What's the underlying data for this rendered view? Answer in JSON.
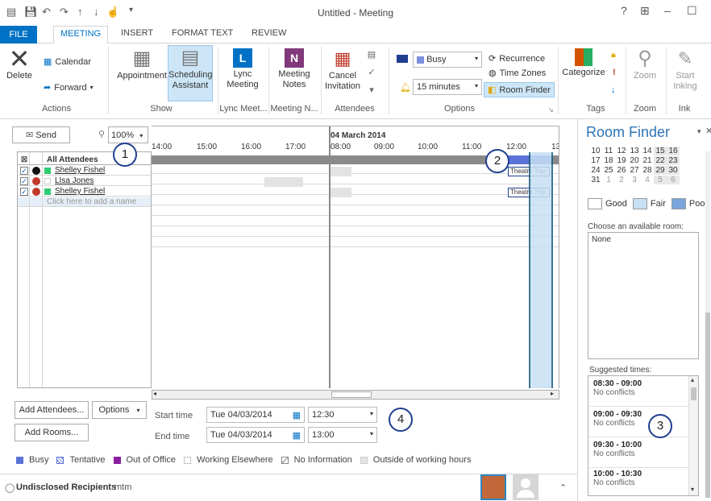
{
  "window": {
    "title": "Untitled - Meeting",
    "help": "?",
    "restore": "⊞",
    "minimize": "–",
    "maximize": "☐"
  },
  "tabs": [
    "FILE",
    "MEETING",
    "INSERT",
    "FORMAT TEXT",
    "REVIEW"
  ],
  "ribbon": {
    "actions": {
      "delete": "Delete",
      "calendar": "Calendar",
      "forward": "Forward",
      "label": "Actions"
    },
    "show": {
      "appointment": "Appointment",
      "scheduling": "Scheduling Assistant",
      "label": "Show"
    },
    "lync": {
      "button": "Lync Meeting",
      "label": "Lync Meet..."
    },
    "notes": {
      "button": "Meeting Notes",
      "label": "Meeting N..."
    },
    "attendees": {
      "cancel": "Cancel Invitation",
      "label": "Attendees"
    },
    "options": {
      "busy": "Busy",
      "reminder": "15 minutes",
      "recurrence": "Recurrence",
      "timezones": "Time Zones",
      "roomfinder": "Room Finder",
      "label": "Options"
    },
    "tags": {
      "categorize": "Categorize",
      "label": "Tags"
    },
    "zoom": {
      "button": "Zoom",
      "label": "Zoom"
    },
    "ink": {
      "button": "Start Inking",
      "label": "Ink"
    }
  },
  "scheduler": {
    "send": "Send",
    "zoom": "100%",
    "header_all": "All Attendees",
    "date": "04 March 2014",
    "hours": [
      "14:00",
      "15:00",
      "16:00",
      "17:00",
      "08:00",
      "09:00",
      "10:00",
      "11:00",
      "12:00",
      "13"
    ],
    "attendees": [
      {
        "name": "Shelley Fishel"
      },
      {
        "name": "LIsa Jones"
      },
      {
        "name": "Shelley Fishel"
      }
    ],
    "add_name": "Click here to add a name",
    "event1": "Theatre Trip",
    "event2": "Theatre Trip",
    "add_attendees": "Add Attendees...",
    "options": "Options",
    "add_rooms": "Add Rooms...",
    "start_label": "Start time",
    "start_date": "Tue 04/03/2014",
    "start_time": "12:30",
    "end_label": "End time",
    "end_date": "Tue 04/03/2014",
    "end_time": "13:00"
  },
  "legend": {
    "busy": "Busy",
    "tentative": "Tentative",
    "oof": "Out of Office",
    "elsewhere": "Working Elsewhere",
    "noinfo": "No Information",
    "outside": "Outside of working hours"
  },
  "status": {
    "recipients": "Undisclosed Recipients",
    "suffix": "mtm"
  },
  "roomfinder": {
    "title": "Room Finder",
    "cal_rows": [
      [
        "10",
        "11",
        "12",
        "13",
        "14",
        "15",
        "16"
      ],
      [
        "17",
        "18",
        "19",
        "20",
        "21",
        "22",
        "23"
      ],
      [
        "24",
        "25",
        "26",
        "27",
        "28",
        "29",
        "30"
      ],
      [
        "31",
        "1",
        "2",
        "3",
        "4",
        "5",
        "6"
      ]
    ],
    "good": "Good",
    "fair": "Fair",
    "poor": "Poor",
    "choose": "Choose an available room:",
    "room_value": "None",
    "suggested": "Suggested times:",
    "times": [
      {
        "time": "08:30 - 09:00",
        "status": "No conflicts"
      },
      {
        "time": "09:00 - 09:30",
        "status": "No conflicts"
      },
      {
        "time": "09:30 - 10:00",
        "status": "No conflicts"
      },
      {
        "time": "10:00 - 10:30",
        "status": "No conflicts"
      }
    ]
  },
  "callouts": [
    "1",
    "2",
    "3",
    "4"
  ],
  "colors": {
    "accent": "#0072c6",
    "busy": "#5b73d6",
    "oof": "#8a1f9e",
    "selection": "#c7e0f4",
    "dark_blue": "#1f3f8f"
  }
}
